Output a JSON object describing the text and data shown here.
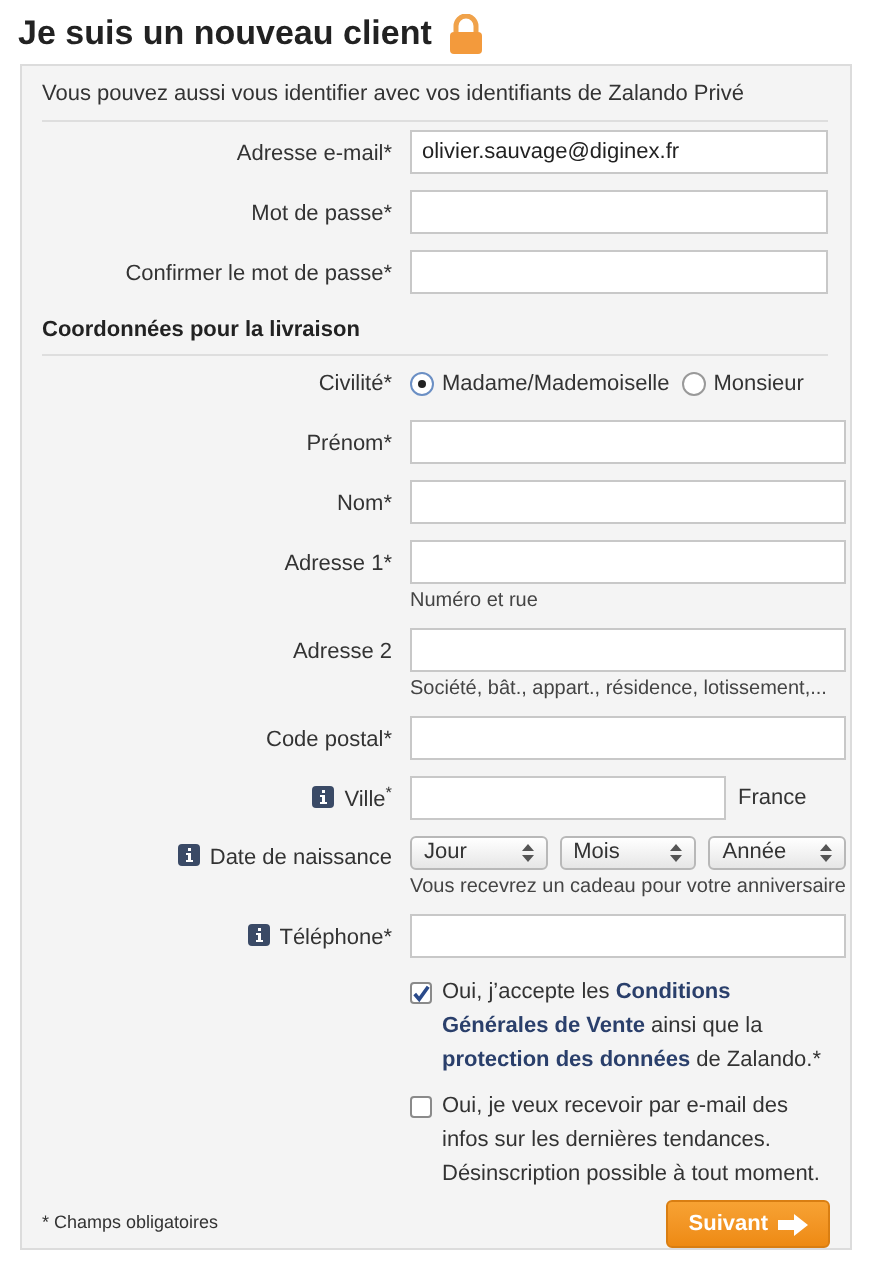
{
  "title": "Je suis un nouveau client",
  "intro": "Vous pouvez aussi vous identifier avec vos identifiants de Zalando Privé",
  "sections": [
    {
      "fields": [
        {
          "kind": "text",
          "label": "Adresse e-mail*",
          "value": "olivier.sauvage@diginex.fr"
        },
        {
          "kind": "text",
          "label": "Mot de passe*"
        },
        {
          "kind": "text",
          "label": "Confirmer le mot de passe*"
        }
      ]
    },
    {
      "heading": "Coordonnées pour la livraison",
      "fields": [
        {
          "kind": "radio",
          "label": "Civilité*",
          "options": [
            {
              "label": "Madame/Mademoiselle",
              "selected": true
            },
            {
              "label": "Monsieur",
              "selected": false
            }
          ]
        },
        {
          "kind": "text",
          "label": "Prénom*"
        },
        {
          "kind": "text",
          "label": "Nom*"
        },
        {
          "kind": "text",
          "label": "Adresse 1*",
          "hint": "Numéro et rue"
        },
        {
          "kind": "text",
          "label": "Adresse 2",
          "hint": "Société, bât., appart., résidence, lotissement,..."
        },
        {
          "kind": "text",
          "label": "Code postal*"
        },
        {
          "kind": "text",
          "label": "Ville$^{*}$",
          "info": true,
          "suffix": "France"
        },
        {
          "kind": "date",
          "label": "Date de naissance",
          "info": true,
          "selects": [
            "Jour",
            "Mois",
            "Année"
          ],
          "hint": "Vous recevrez un cadeau pour votre anniversaire"
        },
        {
          "kind": "text",
          "label": "Téléphone*",
          "info": true
        }
      ]
    }
  ],
  "consents": [
    {
      "checked": true,
      "text": "Oui, j’accepte les **Conditions Générales de Vente** ainsi que la **protection des données** de Zalando.*"
    },
    {
      "checked": false,
      "text": "Oui, je veux recevoir par e-mail des infos sur les dernières tendances. Désinscription possible à tout moment."
    }
  ],
  "footnote": "* Champs obligatoires",
  "submit": {
    "label": "Suivant"
  }
}
